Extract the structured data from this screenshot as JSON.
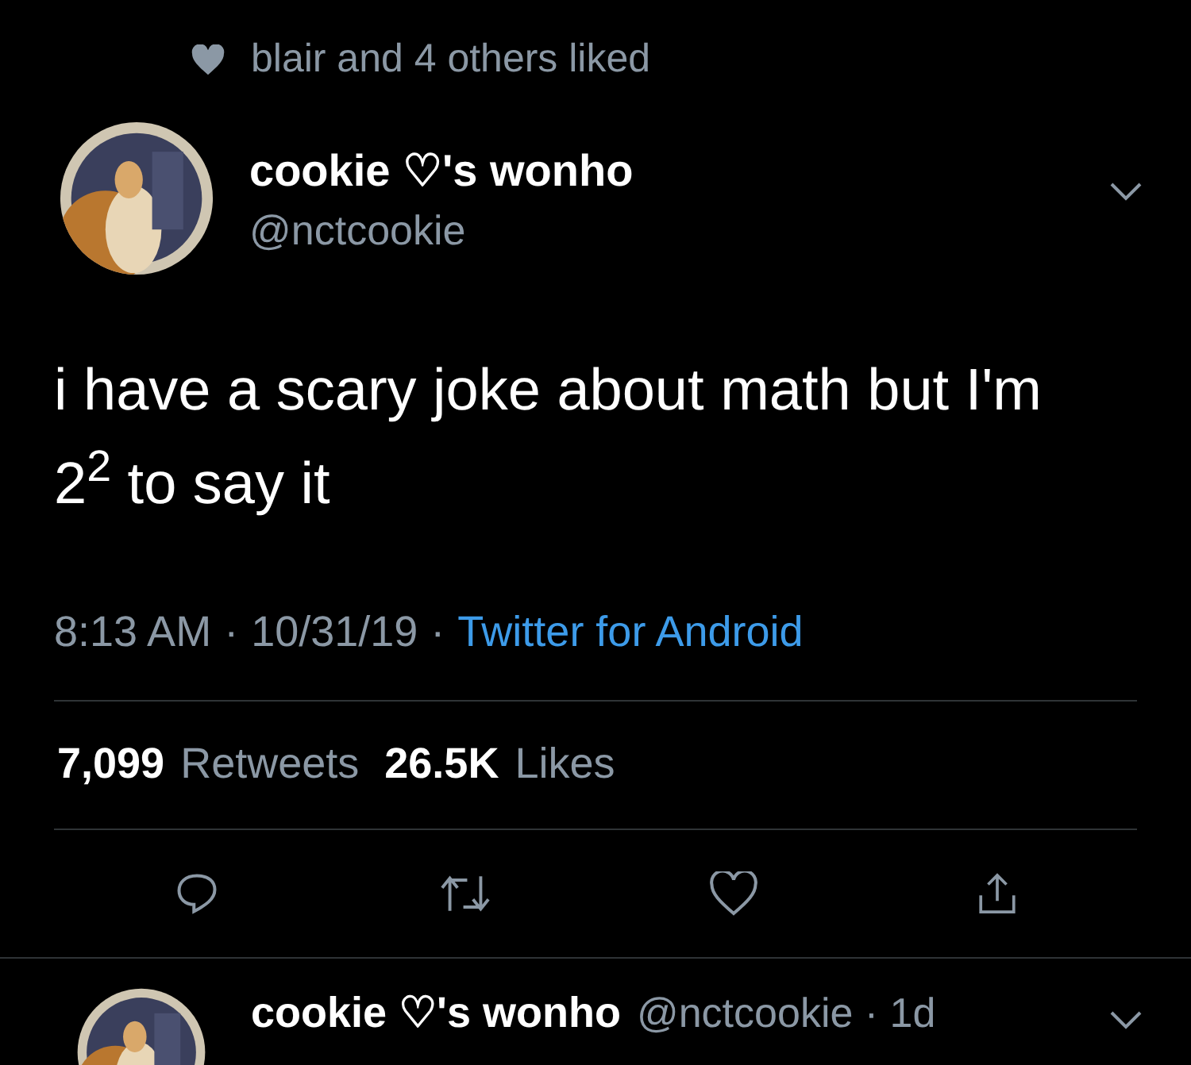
{
  "social_context": {
    "text": "blair and 4 others liked"
  },
  "tweet": {
    "display_name": "cookie ♡'s wonho",
    "handle": "@nctcookie",
    "text": "i have a scary joke about math but I'm 2$^{2}$ to say it",
    "time": "8:13 AM",
    "separator_1": "·",
    "date": "10/31/19",
    "separator_2": "·",
    "source": "Twitter for Android",
    "retweet_count": "7,099",
    "retweet_label": "Retweets",
    "like_count": "26.5K",
    "like_label": "Likes"
  },
  "next_tweet": {
    "display_name": "cookie ♡'s wonho",
    "meta": "@nctcookie · 1d"
  }
}
